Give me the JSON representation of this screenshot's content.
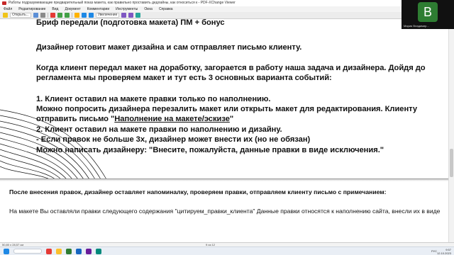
{
  "window": {
    "title": "Работы подразумевающие предварительный показ макета, как правильно проставить дедлайны, как относиться к - PDF-XChange Viewer"
  },
  "menu": {
    "items": [
      "Файл",
      "Редактирование",
      "Вид",
      "Документ",
      "Комментарии",
      "Инструменты",
      "Окна",
      "Справка"
    ]
  },
  "toolbar": {
    "open_label": "Открыть...",
    "zoom_label": "Увеличение",
    "accent": "#e53935"
  },
  "slide": {
    "line0": "Бриф передали (подготовка макета) ПМ + бонус",
    "line1": "Дизайнер готовит макет дизайна и сам отправляет письмо клиенту.",
    "line2": "Когда клиент передал макет на доработку, загорается в работу наша задача и дизайнера. Дойдя до",
    "line3": "регламента мы проверяем макет и тут есть 3 основных варианта событий:",
    "line4": "1. Клиент оставил на макете правки только по наполнению.",
    "line5": "Можно попросить дизайнера перезалить макет или открыть макет для редактирования. Клиенту",
    "line6_prefix": "отправить письмо \"",
    "line6_link": "Наполнение на макете/эскизе",
    "line6_suffix": "\"",
    "line7": "2. Клиент оставил на макете правки по наполнению и дизайну.",
    "line8": "  - Если правок не больше 3х, дизайнер может внести их (но не обязан)",
    "line9": "  Можно написать дизайнеру: \"Внесите, пожалуйста, данные правки в виде исключения.\""
  },
  "page2": {
    "notice": "После внесения правок, дизайнер оставляет напоминалку, проверяем правки, отправляем клиенту письмо с примечанием:",
    "body": "На макете Вы оставляли правки следующего содержания \"цитируем_правки_клиента\" Данные правки относятся к наполнению сайта, внесли их в виде"
  },
  "status": {
    "dimensions": "50,80 x 28,57 см",
    "page_current": "9",
    "page_total": "из 12",
    "lang": "РУС",
    "time": "9:57",
    "date": "12.10.2023"
  },
  "video": {
    "initial": "В",
    "participant": "Мария Владимир..."
  }
}
